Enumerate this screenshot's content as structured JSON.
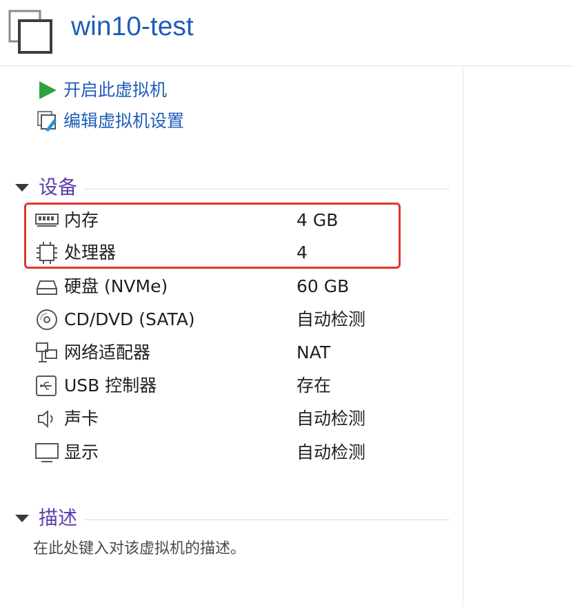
{
  "window": {
    "title": "win10-test",
    "icon": "vm-icon"
  },
  "actions": [
    {
      "label": "开启此虚拟机",
      "icon": "play-icon",
      "color": "#2fa33f"
    },
    {
      "label": "编辑虚拟机设置",
      "icon": "edit-settings-icon"
    }
  ],
  "devices_section": {
    "title": "设备"
  },
  "devices": [
    {
      "name": "内存",
      "value": "4 GB",
      "icon": "memory-icon"
    },
    {
      "name": "处理器",
      "value": "4",
      "icon": "processor-icon"
    },
    {
      "name": "硬盘 (NVMe)",
      "value": "60 GB",
      "icon": "hard-disk-icon"
    },
    {
      "name": "CD/DVD (SATA)",
      "value": "自动检测",
      "icon": "cd-dvd-icon"
    },
    {
      "name": "网络适配器",
      "value": "NAT",
      "icon": "network-adapter-icon"
    },
    {
      "name": "USB 控制器",
      "value": "存在",
      "icon": "usb-controller-icon"
    },
    {
      "name": "声卡",
      "value": "自动检测",
      "icon": "speaker-icon"
    },
    {
      "name": "显示",
      "value": "自动检测",
      "icon": "display-icon"
    }
  ],
  "description_section": {
    "title": "描述",
    "placeholder": "在此处键入对该虚拟机的描述。"
  },
  "colors": {
    "link_blue": "#1f5cb8",
    "section_purple": "#5d3ea8",
    "highlight_red": "#e1352f"
  }
}
